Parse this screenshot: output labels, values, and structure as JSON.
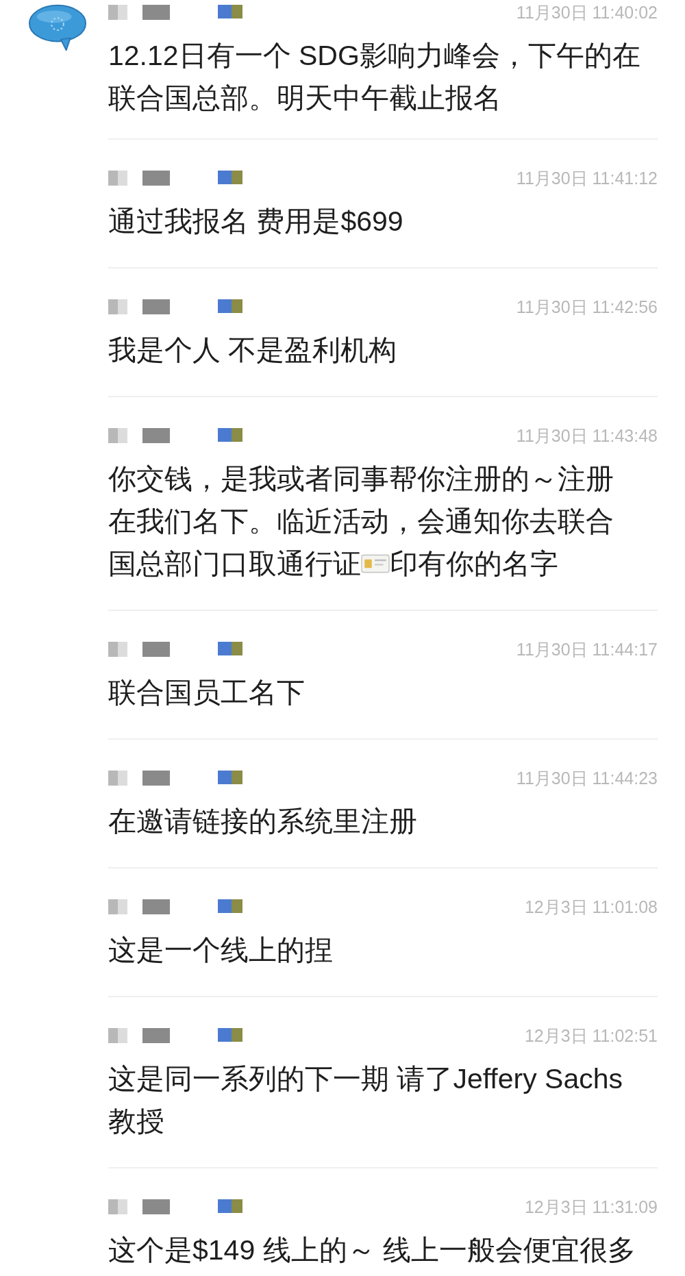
{
  "messages": [
    {
      "has_avatar": true,
      "time": "11月30日 11:40:02",
      "lines": [
        [
          {
            "kind": "text",
            "text": "12.12日有一个 SDG影响力峰会，下午的在"
          }
        ],
        [
          {
            "kind": "text",
            "text": "联合国总部。明天中午截止报名"
          }
        ]
      ]
    },
    {
      "has_avatar": false,
      "time": "11月30日 11:41:12",
      "lines": [
        [
          {
            "kind": "text",
            "text": "通过我报名 费用是$699"
          }
        ]
      ]
    },
    {
      "has_avatar": false,
      "time": "11月30日 11:42:56",
      "lines": [
        [
          {
            "kind": "text",
            "text": "我是个人 不是盈利机构"
          }
        ]
      ]
    },
    {
      "has_avatar": false,
      "time": "11月30日 11:43:48",
      "lines": [
        [
          {
            "kind": "text",
            "text": "你交钱，是我或者同事帮你注册的～注册"
          }
        ],
        [
          {
            "kind": "text",
            "text": "在我们名下。临近活动，会通知你去联合"
          }
        ],
        [
          {
            "kind": "text",
            "text": "国总部门口取通行证"
          },
          {
            "kind": "card-icon"
          },
          {
            "kind": "text",
            "text": "印有你的名字"
          }
        ]
      ]
    },
    {
      "has_avatar": false,
      "time": "11月30日 11:44:17",
      "lines": [
        [
          {
            "kind": "text",
            "text": "联合国员工名下"
          }
        ]
      ]
    },
    {
      "has_avatar": false,
      "time": "11月30日 11:44:23",
      "lines": [
        [
          {
            "kind": "text",
            "text": "在邀请链接的系统里注册"
          }
        ]
      ]
    },
    {
      "has_avatar": false,
      "time": "12月3日 11:01:08",
      "lines": [
        [
          {
            "kind": "text",
            "text": "这是一个线上的捏"
          }
        ]
      ]
    },
    {
      "has_avatar": false,
      "time": "12月3日 11:02:51",
      "lines": [
        [
          {
            "kind": "text",
            "text": "这是同一系列的下一期 请了Jeffery Sachs"
          }
        ],
        [
          {
            "kind": "text",
            "text": "教授"
          }
        ]
      ]
    },
    {
      "has_avatar": false,
      "time": "12月3日 11:31:09",
      "lines": [
        [
          {
            "kind": "text",
            "text": "这个是$149 线上的～ 线上一般会便宜很多"
          }
        ]
      ]
    }
  ]
}
